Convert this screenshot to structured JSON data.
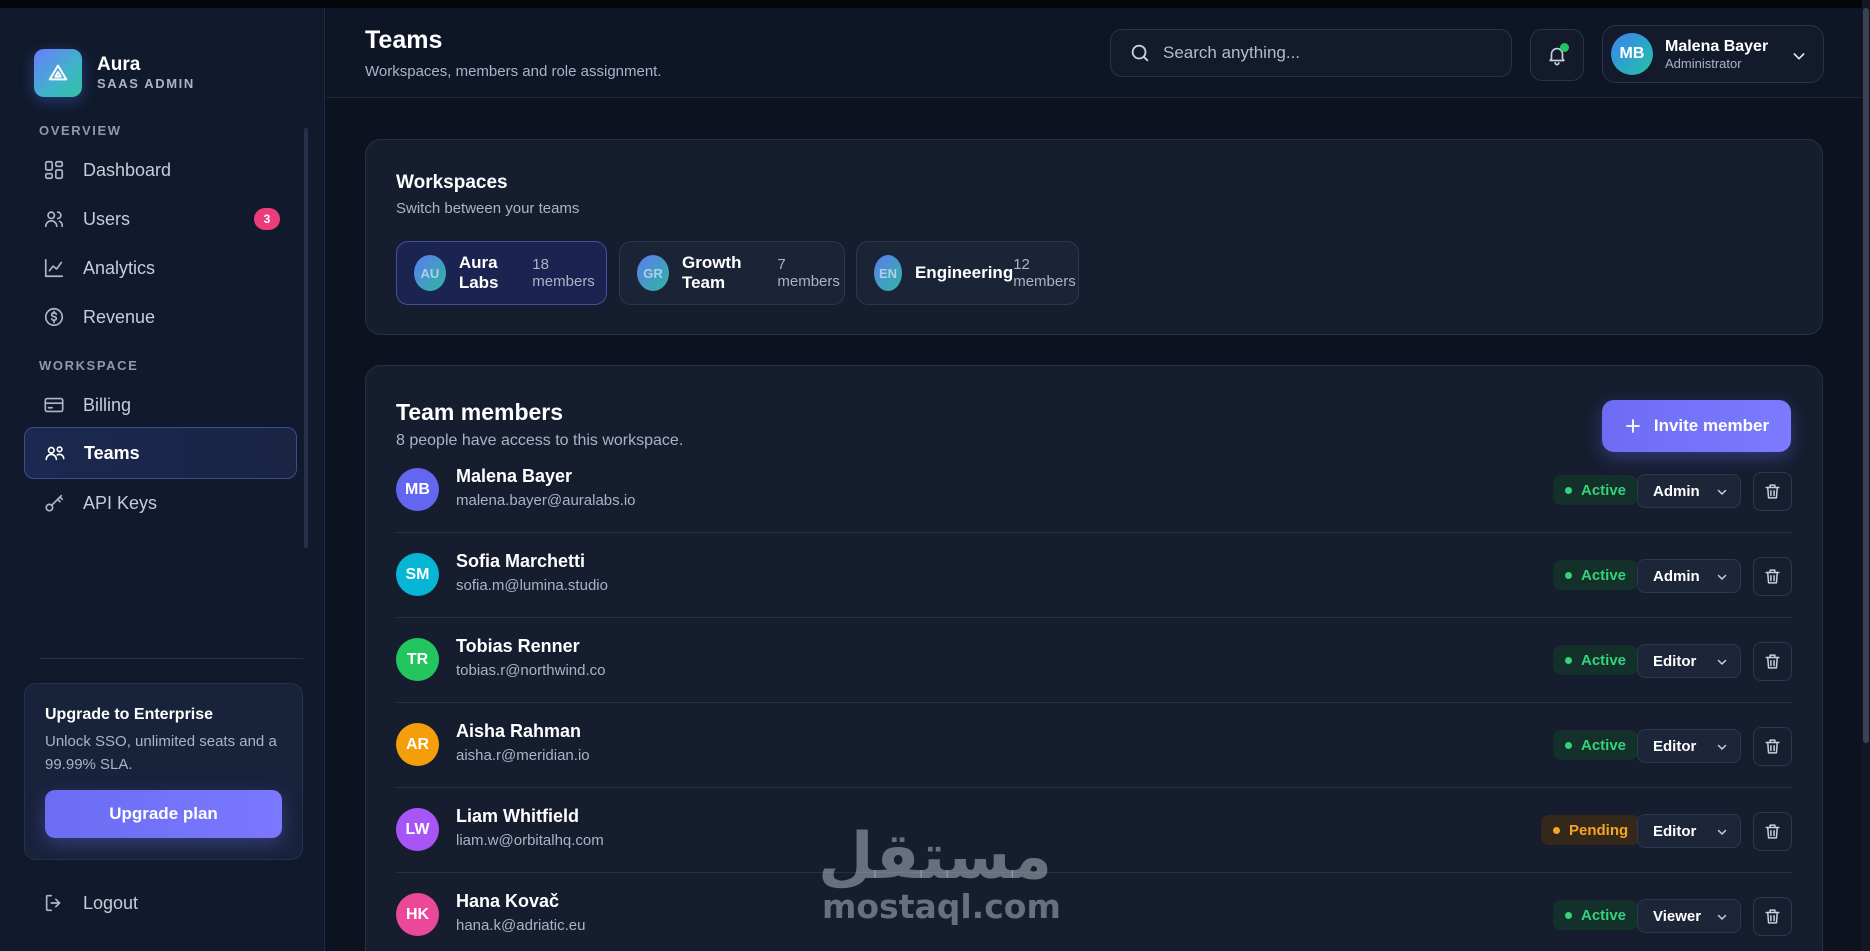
{
  "brand": {
    "name": "Aura",
    "subtitle": "SAAS ADMIN",
    "icon": "triangle-logo-icon"
  },
  "sidebar": {
    "sections": [
      {
        "label": "OVERVIEW"
      },
      {
        "label": "WORKSPACE"
      }
    ],
    "items": [
      {
        "label": "Dashboard",
        "icon": "dashboard-icon"
      },
      {
        "label": "Users",
        "icon": "users-icon",
        "badge": "3"
      },
      {
        "label": "Analytics",
        "icon": "analytics-icon"
      },
      {
        "label": "Revenue",
        "icon": "revenue-icon"
      },
      {
        "label": "Billing",
        "icon": "credit-card-icon"
      },
      {
        "label": "Teams",
        "icon": "teams-icon",
        "active": true
      },
      {
        "label": "API Keys",
        "icon": "key-icon"
      }
    ],
    "upgrade": {
      "title": "Upgrade to Enterprise",
      "text": "Unlock SSO, unlimited seats and a 99.99% SLA.",
      "button": "Upgrade plan"
    },
    "logout": "Logout"
  },
  "header": {
    "title": "Teams",
    "subtitle": "Workspaces, members and role assignment.",
    "search_placeholder": "Search anything...",
    "user": {
      "initials": "MB",
      "name": "Malena Bayer",
      "role": "Administrator"
    }
  },
  "workspaces": {
    "title": "Workspaces",
    "subtitle": "Switch between your teams",
    "items": [
      {
        "initials": "AU",
        "name": "Aura Labs",
        "count": "18 members",
        "active": true
      },
      {
        "initials": "GR",
        "name": "Growth Team",
        "count": "7 members"
      },
      {
        "initials": "EN",
        "name": "Engineering",
        "count": "12 members"
      }
    ]
  },
  "team": {
    "title": "Team members",
    "subtitle": "8 people have access to this workspace.",
    "invite_label": "Invite member",
    "members": [
      {
        "initials": "MB",
        "name": "Malena Bayer",
        "email": "malena.bayer@auralabs.io",
        "status": "Active",
        "role": "Admin",
        "color": "#6366f1"
      },
      {
        "initials": "SM",
        "name": "Sofia Marchetti",
        "email": "sofia.m@lumina.studio",
        "status": "Active",
        "role": "Admin",
        "color": "#06b6d4"
      },
      {
        "initials": "TR",
        "name": "Tobias Renner",
        "email": "tobias.r@northwind.co",
        "status": "Active",
        "role": "Editor",
        "color": "#22c55e"
      },
      {
        "initials": "AR",
        "name": "Aisha Rahman",
        "email": "aisha.r@meridian.io",
        "status": "Active",
        "role": "Editor",
        "color": "#f59e0b"
      },
      {
        "initials": "LW",
        "name": "Liam Whitfield",
        "email": "liam.w@orbitalhq.com",
        "status": "Pending",
        "role": "Editor",
        "color": "#a855f7"
      },
      {
        "initials": "HK",
        "name": "Hana Kovač",
        "email": "hana.k@adriatic.eu",
        "status": "Active",
        "role": "Viewer",
        "color": "#ec4899"
      }
    ]
  },
  "watermark": {
    "arabic": "مستقل",
    "latin": "mostaql.com"
  },
  "colors": {
    "accent": "#6d6cf3",
    "active_status": "#34d27a",
    "pending_status": "#f5a524",
    "badge": "#ec3d7a"
  }
}
